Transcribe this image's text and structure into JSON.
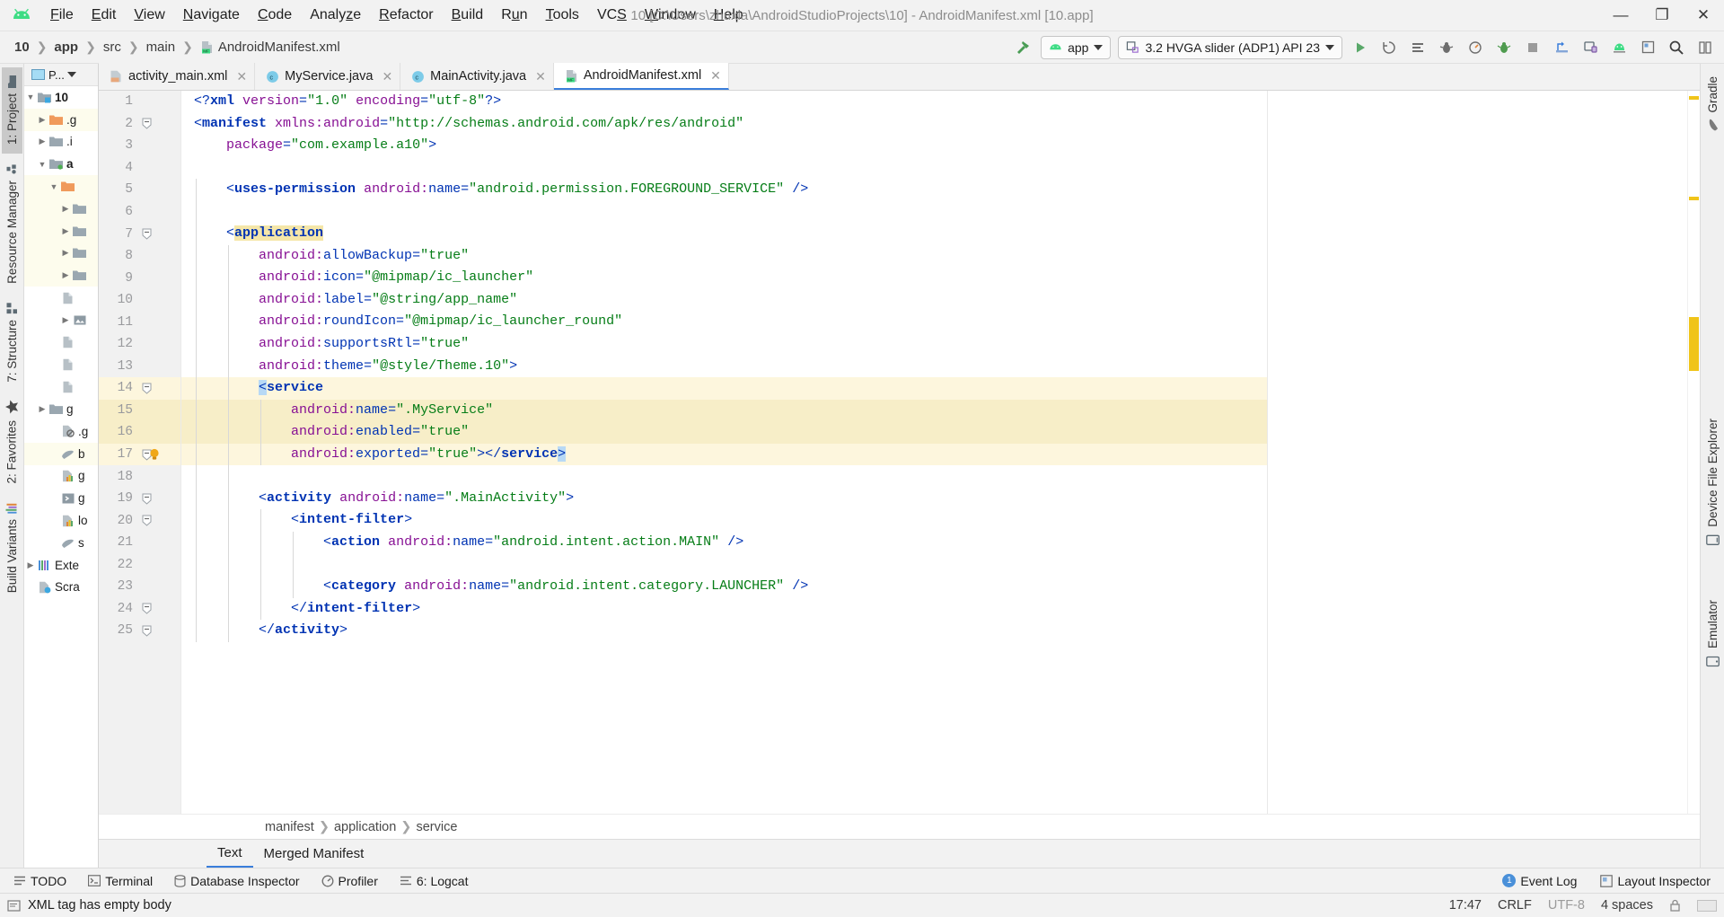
{
  "window": {
    "title": "10 [C:\\Users\\zhuxia\\AndroidStudioProjects\\10] - AndroidManifest.xml [10.app]",
    "minimize": "—",
    "maximize": "❐",
    "close": "✕"
  },
  "menubar": [
    {
      "label": "File",
      "mnemonic": "F"
    },
    {
      "label": "Edit",
      "mnemonic": "E"
    },
    {
      "label": "View",
      "mnemonic": "V"
    },
    {
      "label": "Navigate",
      "mnemonic": "N"
    },
    {
      "label": "Code",
      "mnemonic": "C"
    },
    {
      "label": "Analyze",
      "mnemonic": "z"
    },
    {
      "label": "Refactor",
      "mnemonic": "R"
    },
    {
      "label": "Build",
      "mnemonic": "B"
    },
    {
      "label": "Run",
      "mnemonic": "u"
    },
    {
      "label": "Tools",
      "mnemonic": "T"
    },
    {
      "label": "VCS",
      "mnemonic": "S"
    },
    {
      "label": "Window",
      "mnemonic": "W"
    },
    {
      "label": "Help",
      "mnemonic": "H"
    }
  ],
  "navbar": {
    "crumbs": [
      "10",
      "app",
      "src",
      "main"
    ],
    "file": "AndroidManifest.xml",
    "run_config": "app",
    "device": "3.2  HVGA slider (ADP1) API 23"
  },
  "left_rail": [
    {
      "label": "1: Project",
      "icon": "project-icon",
      "selected": true
    },
    {
      "label": "Resource Manager",
      "icon": "resource-icon",
      "selected": false
    },
    {
      "label": "7: Structure",
      "icon": "structure-icon",
      "selected": false
    },
    {
      "label": "2: Favorites",
      "icon": "star-icon",
      "selected": false
    },
    {
      "label": "Build Variants",
      "icon": "variants-icon",
      "selected": false
    }
  ],
  "right_rail": [
    {
      "label": "Gradle",
      "icon": "gradle-icon"
    },
    {
      "label": "Device File Explorer",
      "icon": "device-file-icon"
    },
    {
      "label": "Emulator",
      "icon": "emulator-icon"
    }
  ],
  "project_panel": {
    "header": "P...",
    "tree": [
      {
        "label": "10",
        "depth": 0,
        "arrow": "down",
        "icon": "module-folder",
        "bold": true,
        "hl": false
      },
      {
        "label": ".g",
        "depth": 1,
        "arrow": "right",
        "icon": "orange-folder",
        "bold": false,
        "hl": true
      },
      {
        "label": ".i",
        "depth": 1,
        "arrow": "right",
        "icon": "gray-folder",
        "bold": false,
        "hl": false
      },
      {
        "label": "a",
        "depth": 1,
        "arrow": "down",
        "icon": "source-folder",
        "bold": true,
        "hl": false
      },
      {
        "label": "",
        "depth": 2,
        "arrow": "down",
        "icon": "orange-folder",
        "bold": false,
        "hl": true
      },
      {
        "label": "",
        "depth": 3,
        "arrow": "right",
        "icon": "gray-folder",
        "bold": false,
        "hl": true
      },
      {
        "label": "",
        "depth": 3,
        "arrow": "right",
        "icon": "gray-folder",
        "bold": false,
        "hl": true
      },
      {
        "label": "",
        "depth": 3,
        "arrow": "right",
        "icon": "gray-folder",
        "bold": false,
        "hl": true
      },
      {
        "label": "",
        "depth": 3,
        "arrow": "right",
        "icon": "gray-folder",
        "bold": false,
        "hl": true
      },
      {
        "label": "",
        "depth": 2,
        "arrow": "none",
        "icon": "file",
        "bold": false,
        "hl": false
      },
      {
        "label": "",
        "depth": 3,
        "arrow": "right",
        "icon": "image-file",
        "bold": false,
        "hl": false
      },
      {
        "label": "",
        "depth": 2,
        "arrow": "none",
        "icon": "file",
        "bold": false,
        "hl": false
      },
      {
        "label": "",
        "depth": 2,
        "arrow": "none",
        "icon": "file",
        "bold": false,
        "hl": false
      },
      {
        "label": "",
        "depth": 2,
        "arrow": "none",
        "icon": "file",
        "bold": false,
        "hl": false
      },
      {
        "label": "g",
        "depth": 1,
        "arrow": "right",
        "icon": "gray-folder",
        "bold": false,
        "hl": false
      },
      {
        "label": ".g",
        "depth": 2,
        "arrow": "none",
        "icon": "ignored-file",
        "bold": false,
        "hl": false
      },
      {
        "label": "b",
        "depth": 2,
        "arrow": "none",
        "icon": "gradle-file",
        "bold": false,
        "hl": true
      },
      {
        "label": "g",
        "depth": 2,
        "arrow": "none",
        "icon": "props-file",
        "bold": false,
        "hl": false
      },
      {
        "label": "g",
        "depth": 2,
        "arrow": "none",
        "icon": "script-file",
        "bold": false,
        "hl": false
      },
      {
        "label": "lo",
        "depth": 2,
        "arrow": "none",
        "icon": "props-file",
        "bold": false,
        "hl": false
      },
      {
        "label": "s",
        "depth": 2,
        "arrow": "none",
        "icon": "gradle-file",
        "bold": false,
        "hl": false
      },
      {
        "label": "Exte",
        "depth": 0,
        "arrow": "right",
        "icon": "libraries-icon",
        "bold": false,
        "hl": false
      },
      {
        "label": "Scra",
        "depth": 0,
        "arrow": "none",
        "icon": "scratch-icon",
        "bold": false,
        "hl": false
      }
    ]
  },
  "tabs": [
    {
      "label": "activity_main.xml",
      "icon": "xml-layout-icon",
      "active": false,
      "closable": true
    },
    {
      "label": "MyService.java",
      "icon": "java-class-icon",
      "active": false,
      "closable": true
    },
    {
      "label": "MainActivity.java",
      "icon": "java-class-icon",
      "active": false,
      "closable": true
    },
    {
      "label": "AndroidManifest.xml",
      "icon": "manifest-icon",
      "active": true,
      "closable": true
    }
  ],
  "editor": {
    "first_line": 1,
    "lines": [
      {
        "n": 1,
        "indent": 0,
        "hl": "none",
        "fold": "",
        "html": "<span class=\"tok-punc\">&lt;?</span><span class=\"tok-pi\">xml </span><span class=\"tok-attr\">version</span><span class=\"tok-punc\">=</span><span class=\"tok-val\">\"1.0\"</span> <span class=\"tok-attr\">encoding</span><span class=\"tok-punc\">=</span><span class=\"tok-val\">\"utf-8\"</span><span class=\"tok-punc\">?&gt;</span>"
      },
      {
        "n": 2,
        "indent": 0,
        "hl": "none",
        "fold": "minus",
        "html": "<span class=\"tok-punc\">&lt;</span><span class=\"tok-tag\">manifest</span> <span class=\"tok-attr\">xmlns:android</span><span class=\"tok-punc\">=</span><span class=\"tok-val\">\"http://schemas.android.com/apk/res/android\"</span>"
      },
      {
        "n": 3,
        "indent": 0,
        "hl": "none",
        "fold": "",
        "html": "    <span class=\"tok-attr\">package</span><span class=\"tok-punc\">=</span><span class=\"tok-val\">\"com.example.a10\"</span><span class=\"tok-punc\">&gt;</span>"
      },
      {
        "n": 4,
        "indent": 0,
        "hl": "none",
        "fold": "",
        "html": ""
      },
      {
        "n": 5,
        "indent": 1,
        "hl": "none",
        "fold": "",
        "html": "    <span class=\"tok-punc\">&lt;</span><span class=\"tok-tag\">uses-permission</span> <span class=\"tok-attr\">android:</span><span class=\"tok-ns\">name</span><span class=\"tok-punc\">=</span><span class=\"tok-val\">\"android.permission.FOREGROUND_SERVICE\"</span> <span class=\"tok-punc\">/&gt;</span>"
      },
      {
        "n": 6,
        "indent": 1,
        "hl": "none",
        "fold": "",
        "html": ""
      },
      {
        "n": 7,
        "indent": 1,
        "hl": "none",
        "fold": "minus",
        "html": "    <span class=\"tok-punc\">&lt;</span><span class=\"tok-tag hl-word\">application</span>"
      },
      {
        "n": 8,
        "indent": 2,
        "hl": "none",
        "fold": "",
        "html": "        <span class=\"tok-attr\">android:</span><span class=\"tok-ns\">allowBackup</span><span class=\"tok-punc\">=</span><span class=\"tok-val\">\"true\"</span>"
      },
      {
        "n": 9,
        "indent": 2,
        "hl": "none",
        "fold": "",
        "html": "        <span class=\"tok-attr\">android:</span><span class=\"tok-ns\">icon</span><span class=\"tok-punc\">=</span><span class=\"tok-val\">\"@mipmap/ic_launcher\"</span>"
      },
      {
        "n": 10,
        "indent": 2,
        "hl": "none",
        "fold": "",
        "html": "        <span class=\"tok-attr\">android:</span><span class=\"tok-ns\">label</span><span class=\"tok-punc\">=</span><span class=\"tok-val\">\"@string/app_name\"</span>"
      },
      {
        "n": 11,
        "indent": 2,
        "hl": "none",
        "fold": "",
        "html": "        <span class=\"tok-attr\">android:</span><span class=\"tok-ns\">roundIcon</span><span class=\"tok-punc\">=</span><span class=\"tok-val\">\"@mipmap/ic_launcher_round\"</span>"
      },
      {
        "n": 12,
        "indent": 2,
        "hl": "none",
        "fold": "",
        "html": "        <span class=\"tok-attr\">android:</span><span class=\"tok-ns\">supportsRtl</span><span class=\"tok-punc\">=</span><span class=\"tok-val\">\"true\"</span>"
      },
      {
        "n": 13,
        "indent": 2,
        "hl": "none",
        "fold": "",
        "html": "        <span class=\"tok-attr\">android:</span><span class=\"tok-ns\">theme</span><span class=\"tok-punc\">=</span><span class=\"tok-val\">\"@style/Theme.10\"</span><span class=\"tok-punc\">&gt;</span>"
      },
      {
        "n": 14,
        "indent": 2,
        "hl": "hl2",
        "fold": "minus",
        "html": "        <span class=\"tok-punc caret-box\">&lt;</span><span class=\"tok-tag\">service</span>"
      },
      {
        "n": 15,
        "indent": 3,
        "hl": "hl",
        "fold": "",
        "html": "            <span class=\"tok-attr\">android:</span><span class=\"tok-ns\">name</span><span class=\"tok-punc\">=</span><span class=\"tok-val\">\".MyService\"</span>"
      },
      {
        "n": 16,
        "indent": 3,
        "hl": "hl",
        "fold": "",
        "html": "            <span class=\"tok-attr\">android:</span><span class=\"tok-ns\">enabled</span><span class=\"tok-punc\">=</span><span class=\"tok-val\">\"true\"</span>"
      },
      {
        "n": 17,
        "indent": 3,
        "hl": "hl2",
        "fold": "minus",
        "bulb": true,
        "html": "            <span class=\"tok-attr\">android:</span><span class=\"tok-ns\">exported</span><span class=\"tok-punc\">=</span><span class=\"tok-val\">\"true\"</span><span class=\"tok-punc\">&gt;&lt;/</span><span class=\"tok-tag\">service</span><span class=\"tok-punc caret-box\">&gt;</span>"
      },
      {
        "n": 18,
        "indent": 2,
        "hl": "none",
        "fold": "",
        "html": ""
      },
      {
        "n": 19,
        "indent": 2,
        "hl": "none",
        "fold": "minus",
        "html": "        <span class=\"tok-punc\">&lt;</span><span class=\"tok-tag\">activity</span> <span class=\"tok-attr\">android:</span><span class=\"tok-ns\">name</span><span class=\"tok-punc\">=</span><span class=\"tok-val\">\".MainActivity\"</span><span class=\"tok-punc\">&gt;</span>"
      },
      {
        "n": 20,
        "indent": 3,
        "hl": "none",
        "fold": "minus",
        "html": "            <span class=\"tok-punc\">&lt;</span><span class=\"tok-tag\">intent-filter</span><span class=\"tok-punc\">&gt;</span>"
      },
      {
        "n": 21,
        "indent": 4,
        "hl": "none",
        "fold": "",
        "html": "                <span class=\"tok-punc\">&lt;</span><span class=\"tok-tag\">action</span> <span class=\"tok-attr\">android:</span><span class=\"tok-ns\">name</span><span class=\"tok-punc\">=</span><span class=\"tok-val\">\"android.intent.action.MAIN\"</span> <span class=\"tok-punc\">/&gt;</span>"
      },
      {
        "n": 22,
        "indent": 4,
        "hl": "none",
        "fold": "",
        "html": ""
      },
      {
        "n": 23,
        "indent": 4,
        "hl": "none",
        "fold": "",
        "html": "                <span class=\"tok-punc\">&lt;</span><span class=\"tok-tag\">category</span> <span class=\"tok-attr\">android:</span><span class=\"tok-ns\">name</span><span class=\"tok-punc\">=</span><span class=\"tok-val\">\"android.intent.category.LAUNCHER\"</span> <span class=\"tok-punc\">/&gt;</span>"
      },
      {
        "n": 24,
        "indent": 3,
        "hl": "none",
        "fold": "minus",
        "html": "            <span class=\"tok-punc\">&lt;/</span><span class=\"tok-tag\">intent-filter</span><span class=\"tok-punc\">&gt;</span>"
      },
      {
        "n": 25,
        "indent": 2,
        "hl": "none",
        "fold": "minus",
        "html": "        <span class=\"tok-punc\">&lt;/</span><span class=\"tok-tag\">activity</span><span class=\"tok-punc\">&gt;</span>"
      }
    ]
  },
  "code_breadcrumbs": [
    "manifest",
    "application",
    "service"
  ],
  "editor_bottom_tabs": [
    {
      "label": "Text",
      "selected": true
    },
    {
      "label": "Merged Manifest",
      "selected": false
    }
  ],
  "bottom_bar": {
    "left": [
      {
        "label": "TODO",
        "icon": "todo-icon"
      },
      {
        "label": "Terminal",
        "icon": "terminal-icon"
      },
      {
        "label": "Database Inspector",
        "icon": "database-icon"
      },
      {
        "label": "Profiler",
        "icon": "profiler-icon"
      },
      {
        "label": "6: Logcat",
        "icon": "logcat-icon"
      }
    ],
    "right": [
      {
        "label": "Event Log",
        "icon": "event-log-icon",
        "badge": "1"
      },
      {
        "label": "Layout Inspector",
        "icon": "layout-inspector-icon",
        "badge": ""
      }
    ]
  },
  "statusbar": {
    "message": "XML tag has empty body",
    "caret": "17:47",
    "line_sep": "CRLF",
    "encoding": "UTF-8",
    "indent": "4 spaces",
    "lock_icon": "lock-icon"
  },
  "colors": {
    "accent": "#3a7edb",
    "highlight": "#f7eec8",
    "highlight_soft": "#fdf6dd",
    "tag": "#0033b3",
    "attr": "#871094",
    "value": "#067d17",
    "android_green": "#3ddc84",
    "titlebar_bg": "#f2f2f2",
    "editor_bg": "#ffffff"
  }
}
